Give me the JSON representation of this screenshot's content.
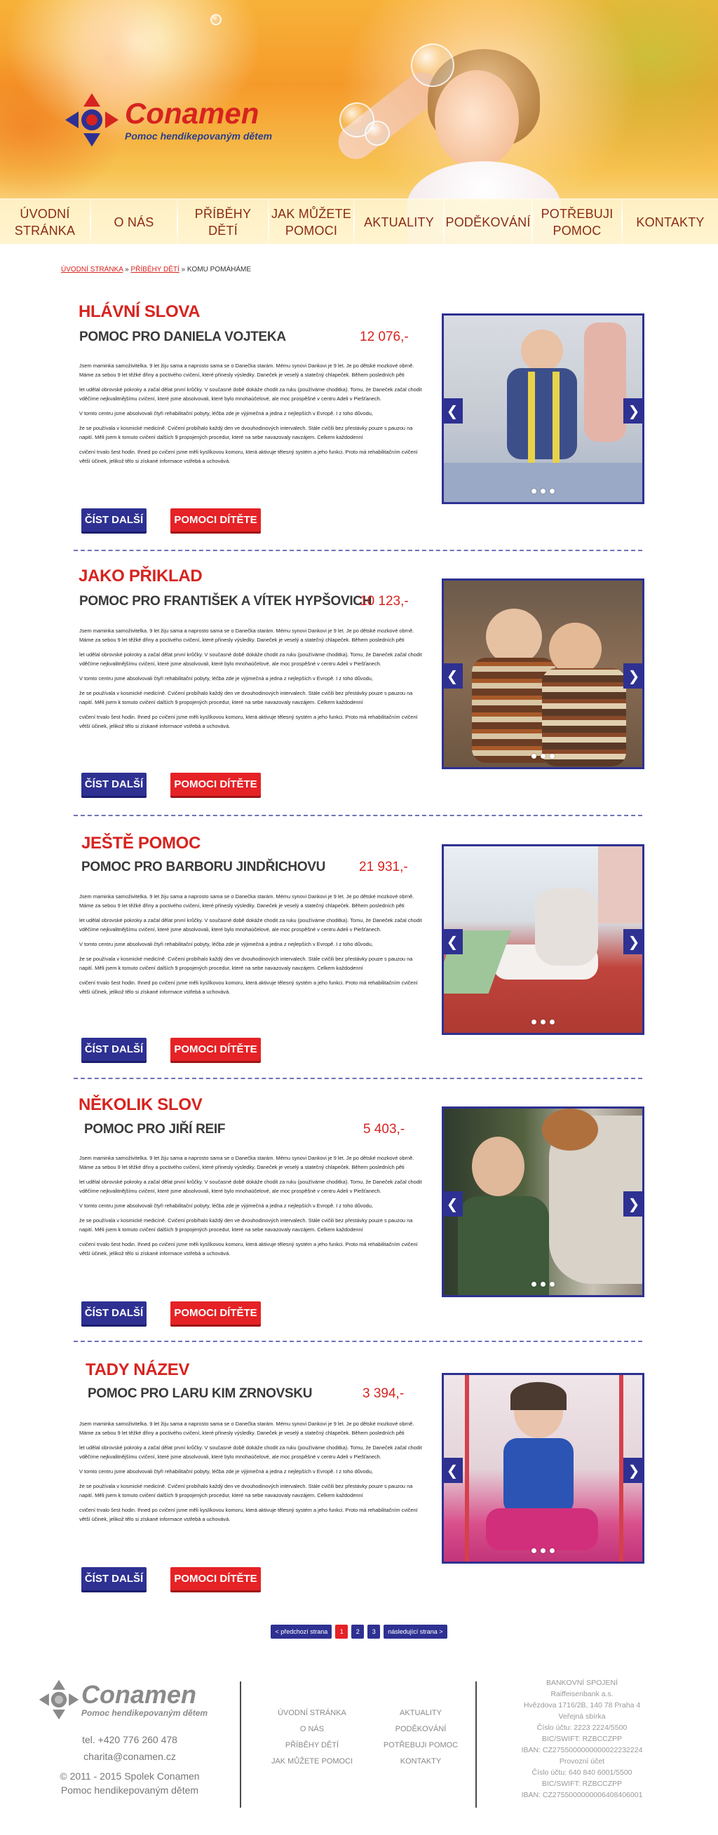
{
  "logo": {
    "name": "Conamen",
    "tagline": "Pomoc hendikepovaným dětem"
  },
  "nav": [
    {
      "line1": "ÚVODNÍ",
      "line2": "STRÁNKA"
    },
    {
      "line1": "O NÁS",
      "line2": ""
    },
    {
      "line1": "PŘÍBĚHY",
      "line2": "DĚTÍ"
    },
    {
      "line1": "JAK MŮŽETE",
      "line2": "POMOCI"
    },
    {
      "line1": "AKTUALITY",
      "line2": ""
    },
    {
      "line1": "PODĚKOVÁNÍ",
      "line2": ""
    },
    {
      "line1": "POTŘEBUJI",
      "line2": "POMOC"
    },
    {
      "line1": "KONTAKTY",
      "line2": ""
    }
  ],
  "breadcrumb": {
    "home": "ÚVODNÍ STRÁNKA",
    "sep": "»",
    "stories": "PŘÍBĚHY DĚTÍ",
    "current": "KOMU POMÁHÁME"
  },
  "body_paragraphs": [
    "Jsem maminka samoživitelka. 9 let žiju sama a naprosto sama se o Danečka starám. Mému synovi Dankovi je 9 let. Je po dětské mozkové obrně. Máme za sebou 9 let těžké dřiny a poctivého cvičení, které přinesly výsledky. Daneček je veselý a statečný chlapeček. Během posledních pěti",
    "let udělal obrovské pokroky a začal dělat první krůčky. V současné době dokáže chodit za ruku (používáme choditka). Tomu, že Daneček začal chodit vděčíme nejkvalitnějšímu cvičení, které jsme absolvovali, které bylo mnohaúčelové, ale moc prospěšné v centru Adeli v Piešťanech.",
    "V tomto centru jsme absolvovali čtyři rehabilitační pobyty, léčba zde je výjimečná a jedna z nejlepších v Evropě. I z toho důvodu,",
    "že se používala v kosmické medicíně. Cvičení probíhalo každý den ve dvouhodinových intervalech. Stále cvičili bez přestávky pouze s pauzou na napití. Měli jsem k tomuto cvičení dalších 9 propojených procedur, které na sebe navazovaly navzájem. Celkem každodenní",
    "cvičení trvalo šest hodin. Ihned po cvičení jsme měli kyslíkovou komoru, která aktivuje tělesný systém a jeho funkci. Proto má rehabilitačním cvičení větší účinek, jelikož tělo si získané informace vstřebá a uchovává."
  ],
  "buttons": {
    "read_more": "ČÍST DALŠÍ",
    "help": "POMOCI DÍTĚTE"
  },
  "articles": [
    {
      "title": "HLÁVNÍ SLOVA",
      "subtitle": "POMOC PRO DANIELA VOJTEKA",
      "amount": "12 076,-"
    },
    {
      "title": "JAKO PŘIKLAD",
      "subtitle": "POMOC PRO FRANTIŠEK A VÍTEK HYPŠOVICH",
      "amount": "10 123,-"
    },
    {
      "title": "JEŠTĚ POMOC",
      "subtitle": "POMOC PRO BARBORU JINDŘICHOVU",
      "amount": "21 931,-"
    },
    {
      "title": "NĚKOLIK SLOV",
      "subtitle": "POMOC PRO JIŘÍ REIF",
      "amount": "5 403,-"
    },
    {
      "title": "TADY NÁZEV",
      "subtitle": "POMOC PRO LARU KIM ZRNOVSKU",
      "amount": "3 394,-"
    }
  ],
  "slider": {
    "prev": "❮",
    "next": "❯"
  },
  "pagination": {
    "prev": "< předchozí strana",
    "pages": [
      "1",
      "2",
      "3"
    ],
    "active_page": "1",
    "next": "následující strana >"
  },
  "footer": {
    "logo_name": "Conamen",
    "logo_tagline": "Pomoc hendikepovaným dětem",
    "phone": "tel. +420 776 260 478",
    "email": "charita@conamen.cz",
    "copyright": "© 2011 - 2015 Spolek Conamen",
    "copyright2": "Pomoc hendikepovaným dětem",
    "links_col1": [
      "ÚVODNÍ STRÁNKA",
      "O NÁS",
      "PŘÍBĚHY DĚTÍ",
      "JAK MŮŽETE POMOCI"
    ],
    "links_col2": [
      "AKTUALITY",
      "PODĚKOVÁNÍ",
      "POTŘEBUJI POMOC",
      "KONTAKTY"
    ],
    "bank": [
      "BANKOVNÍ SPOJENÍ",
      "Raiffeisenbank a.s.",
      "Hvězdova 1716/2B, 140 78 Praha 4",
      "Veřejná sbírka",
      "Číslo účtu: 2223 2224/5500",
      "BIC/SWIFT: RZBCCZPP",
      "IBAN: CZ2755000000000022232224",
      "Provozní účet",
      "Číslo účtu: 640 840 6001/5500",
      "BIC/SWIFT: RZBCCZPP",
      "IBAN: CZ2755000000006408406001"
    ]
  },
  "colors": {
    "brand_red": "#d7231f",
    "brand_blue": "#2e3192",
    "nav_text": "#8c2a14"
  }
}
